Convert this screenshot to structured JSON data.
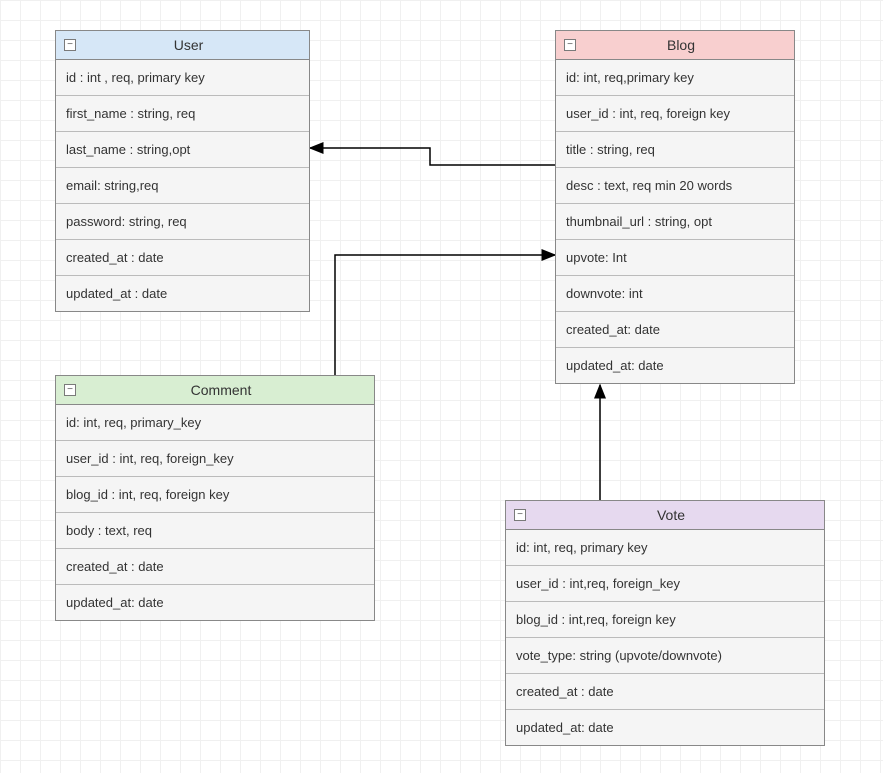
{
  "entities": {
    "user": {
      "title": "User",
      "rows": [
        "id : int , req, primary key",
        "first_name : string, req",
        "last_name : string,opt",
        "email: string,req",
        "password: string, req",
        "created_at : date",
        "updated_at : date"
      ]
    },
    "blog": {
      "title": "Blog",
      "rows": [
        "id: int, req,primary key",
        "user_id : int, req, foreign key",
        "title : string, req",
        "desc : text, req min 20 words",
        "thumbnail_url : string, opt",
        "upvote: Int",
        "downvote: int",
        "created_at: date",
        "updated_at: date"
      ]
    },
    "comment": {
      "title": "Comment",
      "rows": [
        "id: int, req, primary_key",
        "user_id : int, req, foreign_key",
        "blog_id : int, req, foreign key",
        "body : text, req",
        "created_at : date",
        "updated_at: date"
      ]
    },
    "vote": {
      "title": "Vote",
      "rows": [
        "id: int, req, primary key",
        "user_id : int,req, foreign_key",
        "blog_id : int,req, foreign key",
        "vote_type: string (upvote/downvote)",
        "created_at : date",
        "updated_at: date"
      ]
    }
  },
  "relationships": [
    {
      "from": "Blog.user_id",
      "to": "User"
    },
    {
      "from": "Comment.blog_id",
      "to": "Blog"
    },
    {
      "from": "Vote.blog_id",
      "to": "Blog"
    }
  ],
  "collapse_glyph": "−"
}
